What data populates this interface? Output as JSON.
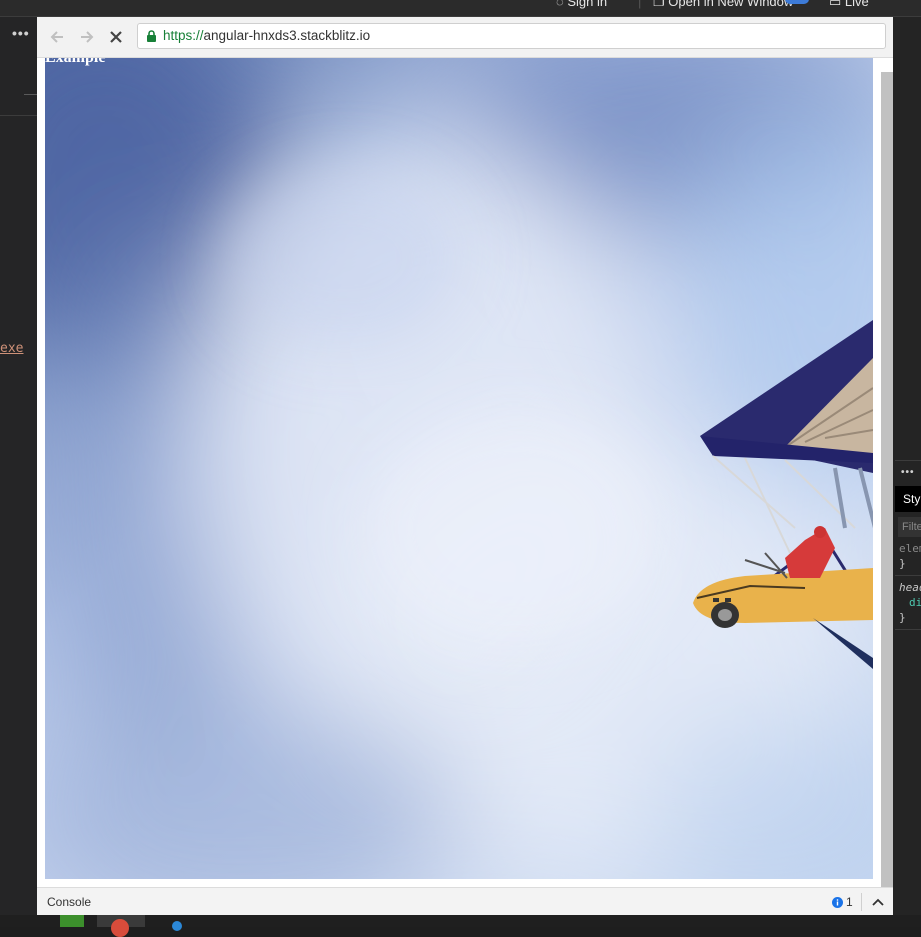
{
  "ide": {
    "topbar": {
      "signin_label": "Sign in",
      "open_window_label": "Open in New Window",
      "live_label": "Live"
    },
    "left_panel": {
      "more_glyph": "•••",
      "code_fragment": "exe"
    },
    "devtools": {
      "more_glyph": "•••",
      "styles_tab": "Styles",
      "filter_placeholder": "Filter",
      "lines": [
        "element.style {",
        "}",
        "head {",
        "display: none;",
        "}"
      ]
    }
  },
  "browser": {
    "url_scheme": "https://",
    "url_host": "angular-hnxds3.stackblitz.io",
    "page_heading": "Example",
    "console_label": "Console",
    "console_info_count": "1"
  },
  "colors": {
    "accent_blue": "#3d7bd8",
    "secure_green": "#188038",
    "info_icon": "#1a73e8"
  }
}
